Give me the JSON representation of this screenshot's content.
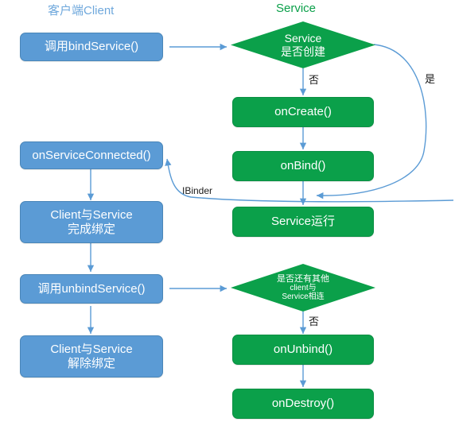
{
  "diagram": {
    "type": "flowchart",
    "title_client": "客户端Client",
    "title_service": "Service",
    "colors": {
      "client_node": "#5B9BD5",
      "service_node": "#0BA04A",
      "arrow": "#5B9BD5",
      "client_title": "#6FA8DC",
      "service_title": "#0BA04A",
      "label_text": "#1a1a1a",
      "background": "#ffffff"
    },
    "client_nodes": [
      {
        "id": "bind",
        "label": "调用bindService()"
      },
      {
        "id": "connected",
        "label": "onServiceConnected()"
      },
      {
        "id": "bound",
        "label": "Client与Service\n完成绑定",
        "line1": "Client与Service",
        "line2": "完成绑定"
      },
      {
        "id": "unbind",
        "label": "调用unbindService()"
      },
      {
        "id": "unbound",
        "label": "Client与Service\n解除绑定",
        "line1": "Client与Service",
        "line2": "解除绑定"
      }
    ],
    "service_nodes": [
      {
        "id": "d1",
        "shape": "diamond",
        "line1": "Service",
        "line2": "是否创建"
      },
      {
        "id": "oncreate",
        "shape": "box",
        "label": "onCreate()"
      },
      {
        "id": "onbind",
        "shape": "box",
        "label": "onBind()"
      },
      {
        "id": "running",
        "shape": "box",
        "label": "Service运行"
      },
      {
        "id": "d2",
        "shape": "diamond",
        "line1": "是否还有其他",
        "line2": "client与",
        "line3": "Service相连"
      },
      {
        "id": "onunbind",
        "shape": "box",
        "label": "onUnbind()"
      },
      {
        "id": "ondestroy",
        "shape": "box",
        "label": "onDestroy()"
      }
    ],
    "edge_labels": {
      "d1_no": "否",
      "d1_yes": "是",
      "ibinder": "IBinder",
      "d2_no": "否"
    },
    "edges": [
      {
        "from": "bind",
        "to": "d1",
        "label": ""
      },
      {
        "from": "d1",
        "to": "oncreate",
        "label": "否"
      },
      {
        "from": "d1",
        "to": "running",
        "label": "是"
      },
      {
        "from": "oncreate",
        "to": "onbind",
        "label": ""
      },
      {
        "from": "onbind",
        "to": "running",
        "label": ""
      },
      {
        "from": "onbind",
        "to": "connected",
        "label": "IBinder"
      },
      {
        "from": "connected",
        "to": "bound",
        "label": ""
      },
      {
        "from": "bound",
        "to": "unbind",
        "label": ""
      },
      {
        "from": "unbind",
        "to": "d2",
        "label": ""
      },
      {
        "from": "d2",
        "to": "onunbind",
        "label": "否"
      },
      {
        "from": "onunbind",
        "to": "ondestroy",
        "label": ""
      },
      {
        "from": "unbind",
        "to": "unbound",
        "label": ""
      }
    ]
  }
}
